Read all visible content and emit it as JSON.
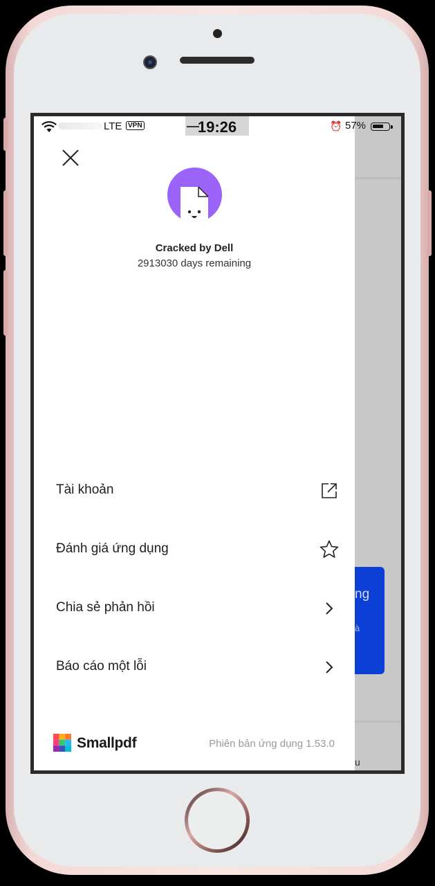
{
  "status_bar": {
    "network": "LTE",
    "vpn": "VPN",
    "time": "19:26",
    "battery": "57%"
  },
  "profile": {
    "name": "Cracked by Dell",
    "subscription": "2913030 days remaining"
  },
  "menu": {
    "items": [
      {
        "label": "Tài khoản",
        "icon": "external-link-icon"
      },
      {
        "label": "Đánh giá ứng dụng",
        "icon": "star-icon"
      },
      {
        "label": "Chia sẻ phản hồi",
        "icon": "chevron-right-icon"
      },
      {
        "label": "Báo cáo một lỗi",
        "icon": "chevron-right-icon"
      }
    ]
  },
  "footer": {
    "brand": "Smallpdf",
    "version": "Phiên bản ứng dụng 1.53.0"
  },
  "background_app": {
    "card_text_1": "ng",
    "card_text_2": "à",
    "bottom_text": "u"
  },
  "colors": {
    "avatar": "#9b63f8",
    "accent_card": "#0b3fd6"
  }
}
